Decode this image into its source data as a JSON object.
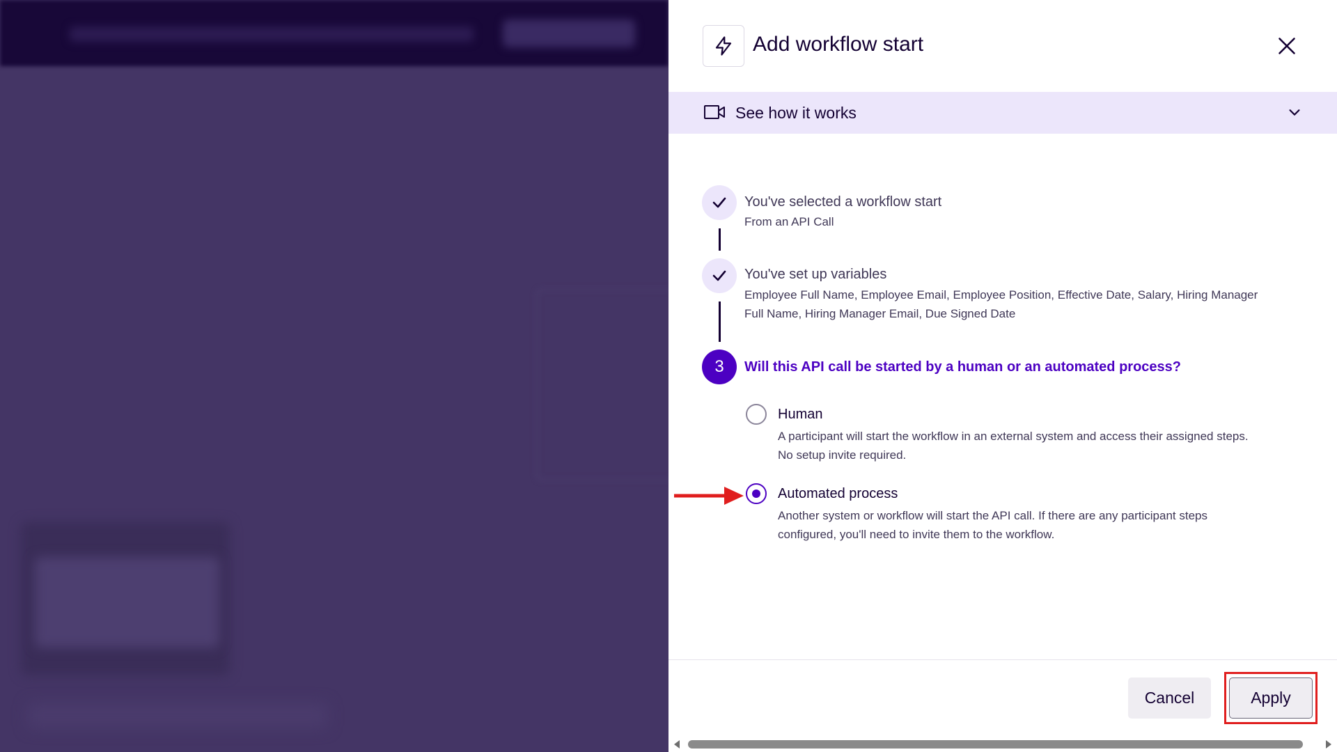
{
  "panel": {
    "title": "Add workflow start",
    "header_icon": "lightning-icon",
    "close_icon": "close-icon"
  },
  "how_it_works": {
    "label": "See how it works",
    "icon": "video-camera-icon",
    "chevron": "chevron-down-icon"
  },
  "steps": [
    {
      "status": "done",
      "title": "You've selected a workflow start",
      "subtitle": "From an API Call"
    },
    {
      "status": "done",
      "title": "You've set up variables",
      "subtitle_line1": "Employee Full Name, Employee Email, Employee Position, Effective Date, Salary, Hiring Manager",
      "subtitle_line2": "Full Name, Hiring Manager Email, Due Signed Date"
    },
    {
      "status": "active",
      "number": "3",
      "question": "Will this API call be started by a human or an automated process?"
    }
  ],
  "options": [
    {
      "label": "Human",
      "desc_line1": "A participant will start the workflow in an external system and access their assigned steps.",
      "desc_line2": "No setup invite required.",
      "selected": false
    },
    {
      "label": "Automated process",
      "desc_line1": "Another system or workflow will start the API call. If there are any participant steps",
      "desc_line2": "configured, you'll need to invite them to the workflow.",
      "selected": true
    }
  ],
  "footer": {
    "cancel_label": "Cancel",
    "apply_label": "Apply"
  },
  "colors": {
    "accent": "#4c00c2",
    "highlight": "#e01e1e",
    "overlay": "#433561"
  }
}
